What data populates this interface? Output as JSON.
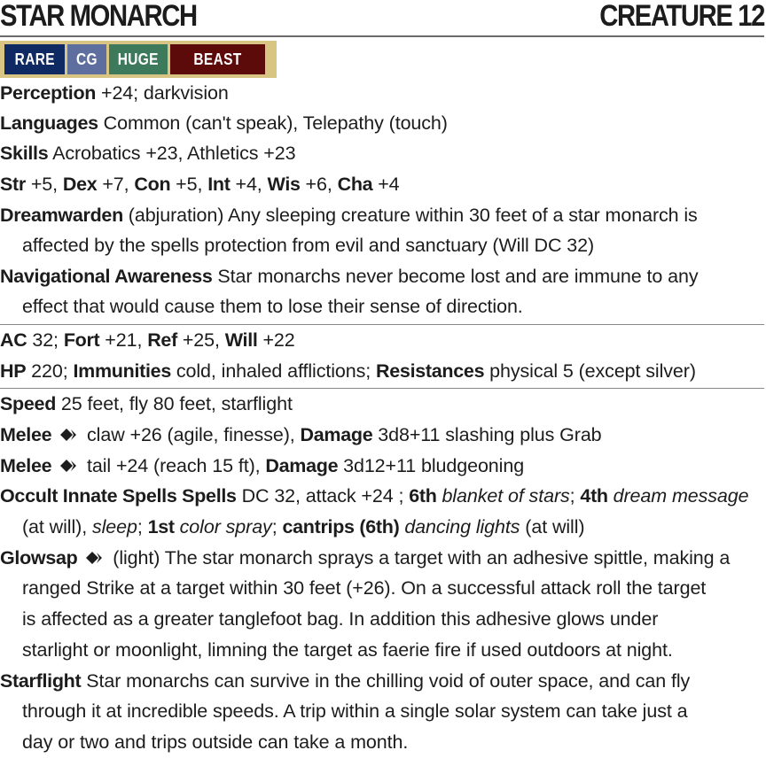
{
  "header": {
    "title": "STAR MONARCH",
    "level": "CREATURE 12"
  },
  "traits": [
    {
      "label": "RARE",
      "color": "#0f2a63"
    },
    {
      "label": "CG",
      "color": "#5e6e9e"
    },
    {
      "label": "HUGE",
      "color": "#3d7a5c"
    },
    {
      "label": "BEAST",
      "color": "#5c0a0a"
    }
  ],
  "colors": {
    "trait_bar": "#d8c483",
    "text": "#1c1c1c",
    "rule": "#8a8a8a"
  },
  "perception": {
    "label": "Perception",
    "text": " +24; darkvision"
  },
  "languages": {
    "label": "Languages",
    "text": " Common (can't speak), Telepathy (touch)"
  },
  "skills": {
    "label": "Skills",
    "text": " Acrobatics +23, Athletics +23"
  },
  "attributes": {
    "str_label": "Str",
    "str": " +5, ",
    "dex_label": "Dex",
    "dex": " +7, ",
    "con_label": "Con",
    "con": " +5, ",
    "int_label": "Int",
    "int": " +4, ",
    "wis_label": "Wis",
    "wis": " +6, ",
    "cha_label": "Cha",
    "cha": " +4"
  },
  "dreamwarden": {
    "label": "Dreamwarden",
    "text1": " (abjuration) Any sleeping creature within 30 feet of a star monarch is",
    "text2": "affected by the spells protection from evil and sanctuary (Will DC 32)"
  },
  "navigational": {
    "label": "Navigational Awareness",
    "text1": " Star monarchs never become lost and are immune to any",
    "text2": "effect that would cause them to lose their sense of direction."
  },
  "defense": {
    "ac_label": "AC",
    "ac": " 32; ",
    "fort_label": "Fort",
    "fort": " +21, ",
    "ref_label": "Ref",
    "ref": " +25, ",
    "will_label": "Will",
    "will": " +22",
    "hp_label": "HP",
    "hp": " 220; ",
    "imm_label": "Immunities",
    "imm": " cold, inhaled afflictions; ",
    "res_label": "Resistances",
    "res": " physical 5 (except silver)"
  },
  "speed": {
    "label": "Speed",
    "text": " 25 feet, fly 80 feet, starflight"
  },
  "melee_claw": {
    "label": "Melee",
    "icon": "single-action-icon",
    "text": " claw +26 (agile, finesse), ",
    "damage_label": "Damage",
    "damage": " 3d8+11 slashing plus Grab"
  },
  "melee_tail": {
    "label": "Melee",
    "icon": "single-action-icon",
    "text": " tail +24 (reach 15 ft), ",
    "damage_label": "Damage",
    "damage": " 3d12+11 bludgeoning"
  },
  "spells": {
    "label": "Occult Innate Spells Spells",
    "dc": " DC 32, attack +24 ; ",
    "r6_label": "6th",
    "r6_spell": "blanket of stars",
    "sep1": "; ",
    "r4_label": "4th",
    "r4_spell": "dream message",
    "atwill1": "(at will)",
    "sep2": ", ",
    "r4_spell2": "sleep",
    "sep3": "; ",
    "r1_label": "1st",
    "r1_spell": "color spray",
    "sep4": "; ",
    "cantrip_label": "cantrips (6th)",
    "cantrip_spell": "dancing lights",
    "atwill2": " (at will)"
  },
  "glowsap": {
    "label": "Glowsap",
    "icon": "single-action-icon",
    "text1": " (light) The star monarch sprays a target with an adhesive spittle, making a",
    "text2": "ranged Strike at a target within 30 feet (+26). On a successful attack roll the target",
    "text3": "is affected as a greater tanglefoot bag. In addition this adhesive glows under",
    "text4": "starlight or moonlight, limning the target as faerie fire if used outdoors at night."
  },
  "starflight": {
    "label": "Starflight",
    "text1": " Star monarchs can survive in the chilling void of outer space, and can fly",
    "text2": "through it at incredible speeds. A trip within a single solar system can take just a",
    "text3": "day or two and trips outside can take a month."
  }
}
